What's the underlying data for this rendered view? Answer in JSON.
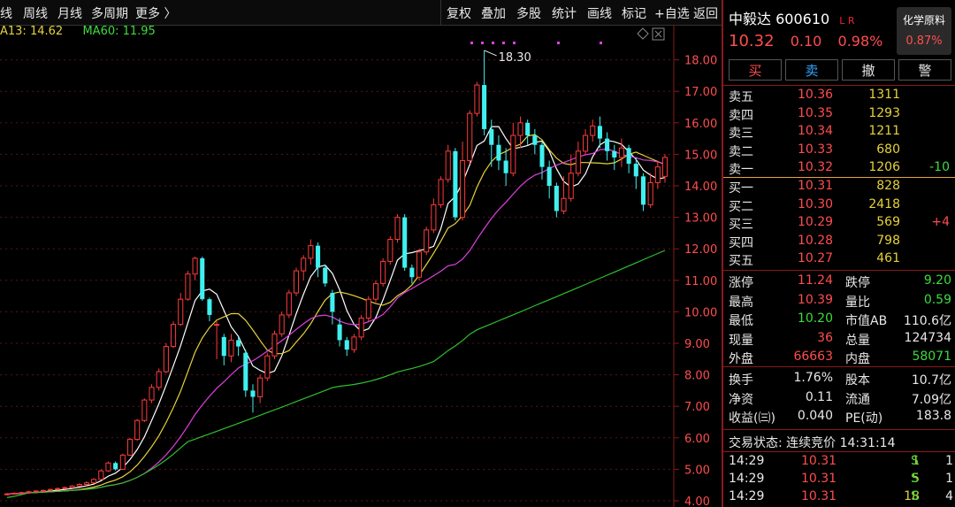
{
  "toolbar": {
    "left": [
      "线",
      "周线",
      "月线",
      "多周期",
      "更多 〉"
    ],
    "right": [
      "复权",
      "叠加",
      "多股",
      "统计",
      "画线",
      "标记",
      "+自选",
      "返回"
    ]
  },
  "ma": [
    {
      "label": "A13: 14.62",
      "color": "#e6d23a"
    },
    {
      "label": "MA60: 11.95",
      "color": "#3ddc3d"
    }
  ],
  "chart_data": {
    "type": "candlestick",
    "ylim": [
      4.0,
      19.0
    ],
    "yticks": [
      4,
      5,
      6,
      7,
      8,
      9,
      10,
      11,
      12,
      13,
      14,
      15,
      16,
      17,
      18
    ],
    "ytick_labels": [
      "4.00",
      "5.00",
      "6.00",
      "7.00",
      "8.00",
      "9.00",
      "10.00",
      "11.00",
      "12.00",
      "13.00",
      "14.00",
      "15.00",
      "16.00",
      "17.00",
      "18.00"
    ],
    "annotation": {
      "text": "18.30",
      "value": 18.3
    },
    "candles": [
      [
        4.2,
        4.22,
        4.17,
        4.25
      ],
      [
        4.22,
        4.24,
        4.2,
        4.27
      ],
      [
        4.24,
        4.26,
        4.22,
        4.29
      ],
      [
        4.26,
        4.29,
        4.24,
        4.32
      ],
      [
        4.29,
        4.31,
        4.27,
        4.34
      ],
      [
        4.31,
        4.33,
        4.29,
        4.36
      ],
      [
        4.33,
        4.36,
        4.31,
        4.39
      ],
      [
        4.36,
        4.39,
        4.34,
        4.42
      ],
      [
        4.39,
        4.42,
        4.37,
        4.45
      ],
      [
        4.42,
        4.47,
        4.4,
        4.5
      ],
      [
        4.47,
        4.52,
        4.45,
        4.55
      ],
      [
        4.52,
        4.57,
        4.5,
        4.62
      ],
      [
        4.57,
        4.68,
        4.55,
        4.72
      ],
      [
        4.68,
        4.95,
        4.66,
        5.0
      ],
      [
        4.95,
        5.2,
        4.92,
        5.25
      ],
      [
        5.2,
        5.0,
        4.96,
        5.25
      ],
      [
        5.0,
        5.45,
        4.98,
        5.5
      ],
      [
        5.45,
        5.95,
        5.42,
        6.0
      ],
      [
        5.95,
        6.55,
        5.9,
        6.6
      ],
      [
        6.55,
        7.2,
        6.5,
        7.25
      ],
      [
        7.2,
        7.6,
        7.1,
        7.7
      ],
      [
        7.6,
        8.1,
        7.5,
        8.2
      ],
      [
        8.1,
        8.9,
        8.05,
        9.0
      ],
      [
        8.9,
        9.6,
        8.85,
        9.7
      ],
      [
        9.6,
        10.4,
        9.55,
        10.6
      ],
      [
        10.4,
        11.2,
        10.35,
        11.3
      ],
      [
        11.2,
        11.7,
        11.0,
        11.75
      ],
      [
        11.7,
        10.4,
        10.35,
        11.75
      ],
      [
        10.4,
        9.9,
        9.7,
        10.45
      ],
      [
        9.6,
        9.6,
        8.5,
        9.7
      ],
      [
        9.2,
        8.6,
        8.3,
        9.3
      ],
      [
        8.6,
        9.1,
        8.4,
        9.3
      ],
      [
        9.1,
        8.9,
        8.6,
        9.2
      ],
      [
        8.7,
        7.5,
        7.3,
        8.8
      ],
      [
        7.5,
        7.3,
        6.8,
        7.7
      ],
      [
        7.3,
        7.9,
        7.1,
        8.0
      ],
      [
        7.9,
        8.6,
        7.8,
        8.7
      ],
      [
        8.6,
        9.3,
        8.5,
        9.4
      ],
      [
        9.3,
        9.9,
        9.2,
        10.0
      ],
      [
        9.9,
        10.6,
        9.8,
        10.7
      ],
      [
        10.6,
        11.3,
        10.5,
        11.4
      ],
      [
        11.3,
        11.7,
        11.0,
        11.8
      ],
      [
        11.7,
        12.1,
        11.5,
        12.3
      ],
      [
        12.1,
        11.4,
        11.1,
        12.2
      ],
      [
        11.4,
        10.9,
        10.8,
        11.5
      ],
      [
        10.6,
        10.0,
        9.6,
        10.7
      ],
      [
        9.6,
        9.1,
        8.9,
        9.8
      ],
      [
        9.1,
        8.8,
        8.6,
        9.2
      ],
      [
        8.8,
        9.2,
        8.7,
        9.3
      ],
      [
        9.2,
        9.8,
        9.1,
        9.9
      ],
      [
        9.8,
        10.4,
        9.7,
        10.5
      ],
      [
        10.4,
        10.9,
        10.3,
        11.0
      ],
      [
        10.9,
        11.6,
        10.8,
        11.7
      ],
      [
        11.6,
        12.3,
        11.5,
        12.4
      ],
      [
        12.3,
        13.0,
        12.2,
        13.1
      ],
      [
        13.0,
        11.4,
        11.3,
        13.1
      ],
      [
        11.4,
        11.1,
        10.9,
        11.5
      ],
      [
        11.1,
        11.9,
        11.0,
        12.0
      ],
      [
        11.9,
        12.6,
        11.8,
        12.7
      ],
      [
        12.6,
        13.4,
        12.5,
        13.6
      ],
      [
        13.4,
        14.2,
        13.3,
        14.3
      ],
      [
        14.2,
        15.1,
        14.1,
        15.3
      ],
      [
        15.1,
        13.0,
        12.9,
        15.2
      ],
      [
        13.0,
        14.8,
        12.9,
        15.4
      ],
      [
        14.8,
        16.3,
        14.7,
        16.4
      ],
      [
        16.3,
        17.2,
        16.2,
        17.3
      ],
      [
        17.2,
        15.8,
        15.6,
        18.3
      ],
      [
        15.8,
        15.3,
        14.6,
        16.1
      ],
      [
        15.3,
        14.8,
        14.5,
        15.6
      ],
      [
        14.8,
        14.4,
        14.0,
        15.2
      ],
      [
        14.4,
        15.6,
        14.3,
        16.0
      ],
      [
        15.6,
        16.0,
        15.2,
        16.2
      ],
      [
        16.0,
        15.6,
        15.3,
        16.1
      ],
      [
        15.6,
        15.3,
        15.0,
        15.8
      ],
      [
        15.3,
        14.6,
        14.2,
        15.4
      ],
      [
        14.6,
        14.0,
        13.6,
        14.8
      ],
      [
        14.0,
        13.2,
        13.0,
        14.1
      ],
      [
        13.2,
        13.6,
        13.1,
        14.3
      ],
      [
        13.6,
        14.4,
        13.5,
        15.0
      ],
      [
        14.4,
        15.1,
        14.3,
        15.4
      ],
      [
        15.1,
        15.6,
        15.0,
        15.8
      ],
      [
        15.6,
        15.9,
        15.4,
        16.1
      ],
      [
        15.9,
        15.5,
        15.2,
        16.2
      ],
      [
        15.5,
        15.1,
        14.8,
        15.7
      ],
      [
        15.1,
        14.9,
        14.5,
        15.3
      ],
      [
        14.9,
        15.2,
        14.6,
        15.5
      ],
      [
        15.2,
        14.7,
        14.4,
        15.3
      ],
      [
        14.7,
        14.3,
        13.9,
        14.9
      ],
      [
        14.3,
        13.4,
        13.2,
        14.4
      ],
      [
        13.4,
        14.1,
        13.3,
        14.4
      ],
      [
        14.1,
        14.6,
        13.9,
        14.8
      ],
      [
        14.3,
        14.9,
        14.1,
        15.0
      ]
    ]
  },
  "panel": {
    "name": "中毅达",
    "code": "600610",
    "tag": "L R",
    "price": "10.32",
    "change": "0.10",
    "pct": "0.98%",
    "industry_name": "化学原料",
    "industry_pct": "0.87%",
    "buttons": [
      {
        "label": "买",
        "color": "#ff4d4d"
      },
      {
        "label": "卖",
        "color": "#36a3ff"
      },
      {
        "label": "撤",
        "color": "#e8e8e8"
      },
      {
        "label": "警",
        "color": "#e8e8e8"
      }
    ],
    "asks": [
      {
        "label": "卖五",
        "price": "10.36",
        "vol": "1311",
        "chg": ""
      },
      {
        "label": "卖四",
        "price": "10.35",
        "vol": "1293",
        "chg": ""
      },
      {
        "label": "卖三",
        "price": "10.34",
        "vol": "1211",
        "chg": ""
      },
      {
        "label": "卖二",
        "price": "10.33",
        "vol": "680",
        "chg": ""
      },
      {
        "label": "卖一",
        "price": "10.32",
        "vol": "1206",
        "chg": "-10"
      }
    ],
    "bids": [
      {
        "label": "买一",
        "price": "10.31",
        "vol": "828",
        "chg": ""
      },
      {
        "label": "买二",
        "price": "10.30",
        "vol": "2418",
        "chg": ""
      },
      {
        "label": "买三",
        "price": "10.29",
        "vol": "569",
        "chg": "+4"
      },
      {
        "label": "买四",
        "price": "10.28",
        "vol": "798",
        "chg": ""
      },
      {
        "label": "买五",
        "price": "10.27",
        "vol": "461",
        "chg": ""
      }
    ],
    "stats1": [
      {
        "k1": "涨停",
        "v1": "11.24",
        "c1": "red",
        "k2": "跌停",
        "v2": "9.20",
        "c2": "green"
      },
      {
        "k1": "最高",
        "v1": "10.39",
        "c1": "red",
        "k2": "量比",
        "v2": "0.59",
        "c2": "green"
      },
      {
        "k1": "最低",
        "v1": "10.20",
        "c1": "green",
        "k2": "市值AB",
        "v2": "110.6亿",
        "c2": "white"
      },
      {
        "k1": "现量",
        "v1": "36",
        "c1": "red",
        "k2": "总量",
        "v2": "124734",
        "c2": "white"
      },
      {
        "k1": "外盘",
        "v1": "66663",
        "c1": "red",
        "k2": "内盘",
        "v2": "58071",
        "c2": "green"
      }
    ],
    "stats2": [
      {
        "k1": "换手",
        "v1": "1.76%",
        "c1": "white",
        "k2": "股本",
        "v2": "10.7亿",
        "c2": "white"
      },
      {
        "k1": "净资",
        "v1": "0.11",
        "c1": "white",
        "k2": "流通",
        "v2": "7.09亿",
        "c2": "white"
      },
      {
        "k1": "收益(㈢)",
        "v1": "0.040",
        "c1": "white",
        "k2": "PE(动)",
        "v2": "183.8",
        "c2": "white"
      }
    ],
    "status": "交易状态: 连续竞价 14:31:14",
    "ticks": [
      {
        "time": "14:29",
        "price": "10.31",
        "vol": "1",
        "side": "S",
        "n": "1"
      },
      {
        "time": "14:29",
        "price": "10.31",
        "vol": "5",
        "side": "S",
        "n": "1"
      },
      {
        "time": "14:29",
        "price": "10.31",
        "vol": "18",
        "side": "S",
        "n": "4"
      }
    ]
  }
}
